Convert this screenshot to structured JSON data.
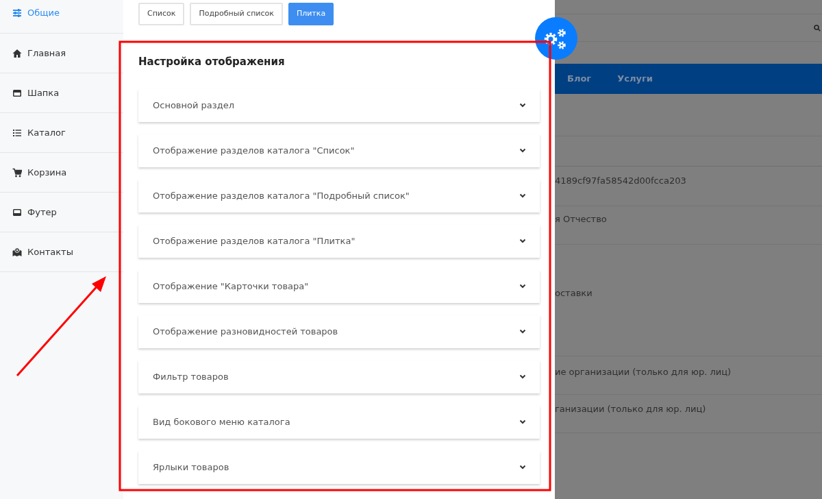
{
  "sidebar": {
    "items": [
      {
        "label": "Общие",
        "selected": true
      },
      {
        "label": "Главная",
        "selected": false
      },
      {
        "label": "Шапка",
        "selected": false
      },
      {
        "label": "Каталог",
        "selected": false
      },
      {
        "label": "Корзина",
        "selected": false
      },
      {
        "label": "Футер",
        "selected": false
      },
      {
        "label": "Контакты",
        "selected": false
      }
    ]
  },
  "view_buttons": [
    {
      "label": "Список",
      "selected": false
    },
    {
      "label": "Подробный список",
      "selected": false
    },
    {
      "label": "Плитка",
      "selected": true
    }
  ],
  "section": {
    "title": "Настройка отображения",
    "items": [
      {
        "label": "Основной раздел",
        "expanded": false
      },
      {
        "label": "Отображение разделов каталога \"Список\"",
        "expanded": false
      },
      {
        "label": "Отображение разделов каталога \"Подробный список\"",
        "expanded": false
      },
      {
        "label": "Отображение разделов каталога \"Плитка\"",
        "expanded": false
      },
      {
        "label": "Отображение \"Карточки товара\"",
        "expanded": false
      },
      {
        "label": "Отображение разновидностей товаров",
        "expanded": false
      },
      {
        "label": "Фильтр товаров",
        "expanded": false
      },
      {
        "label": "Вид бокового меню каталога",
        "expanded": false
      },
      {
        "label": "Ярлыки товаров",
        "expanded": false
      }
    ]
  },
  "background_page": {
    "nav": [
      "Блог",
      "Услуги"
    ],
    "rows": [
      "4189cf97fa58542d00fcca203",
      "я Отчество",
      "оставки",
      "ие организации (только для юр. лиц)",
      "ганизации (только для юр. лиц)"
    ]
  }
}
